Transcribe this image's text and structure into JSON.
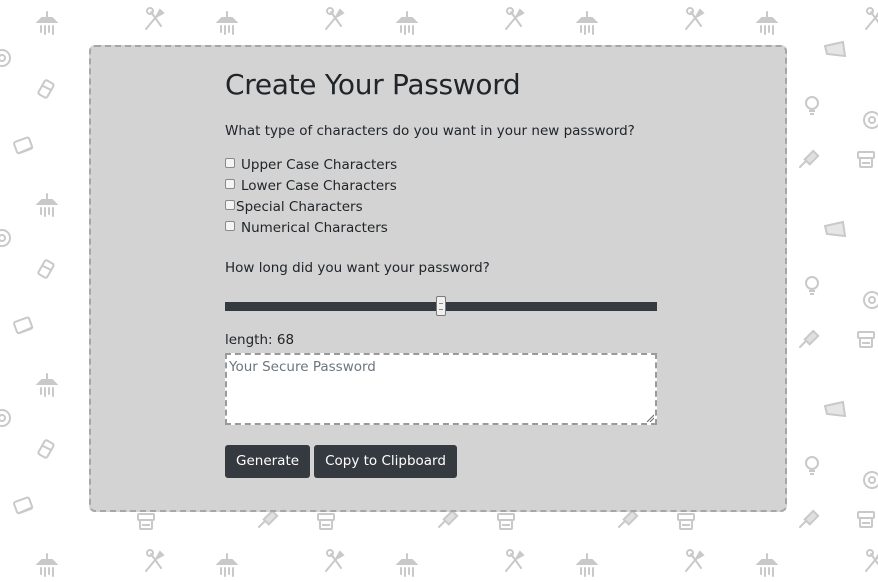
{
  "page": {
    "title": "Create Your Password"
  },
  "form": {
    "character_question": "What type of characters do you want in your new password?",
    "options": [
      {
        "label": "Upper Case Characters",
        "checked": false
      },
      {
        "label": "Lower Case Characters",
        "checked": false
      },
      {
        "label": "Special Characters",
        "checked": false
      },
      {
        "label": "Numerical Characters",
        "checked": false
      }
    ],
    "length_question": "How long did you want your password?",
    "length_slider": {
      "value": 68,
      "min": 8,
      "max": 128
    },
    "length_label": "length: 68",
    "password_placeholder": "Your Secure Password",
    "generate_label": "Generate",
    "copy_label": "Copy to Clipboard"
  },
  "theme": {
    "card_background": "#d3d3d3",
    "button_background": "#343a40",
    "button_text": "#ffffff"
  },
  "background_icons": [
    "shower-icon",
    "garden-tools-icon",
    "lightbulb-icon",
    "paint-brush-icon",
    "toaster-icon",
    "bin-icon",
    "roller-icon",
    "gear-icon"
  ]
}
